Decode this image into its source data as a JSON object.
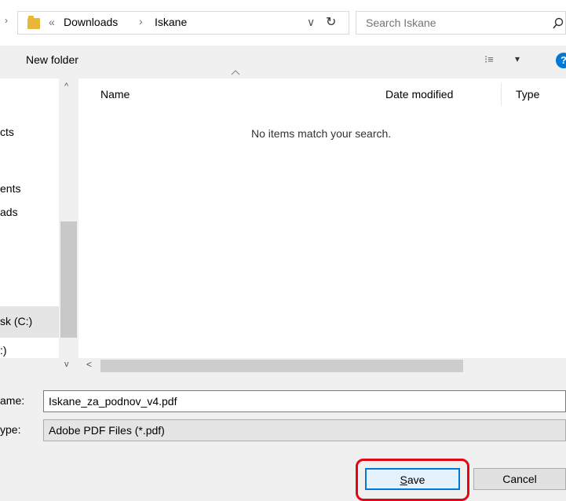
{
  "address": {
    "crumbs": [
      "«",
      "Downloads",
      "›",
      "Iskane"
    ],
    "dropdown_glyph": "∨",
    "refresh_glyph": "↻"
  },
  "search": {
    "placeholder": "Search Iskane",
    "icon": "search-icon"
  },
  "toolbar": {
    "new_folder": "New folder",
    "view_glyph": "⁝≡",
    "view_arrow": "▾",
    "help_glyph": "?"
  },
  "columns": {
    "name": "Name",
    "date_modified": "Date modified",
    "type": "Type"
  },
  "list": {
    "empty_message": "No items match your search."
  },
  "nav": {
    "items": [
      "cts",
      "ents",
      "ads",
      "sk (C:)",
      ":)"
    ],
    "up_arrow": "^",
    "down_arrow": "v"
  },
  "hscroll": {
    "left_arrow": "<"
  },
  "form": {
    "filename_label": "ame:",
    "filename_value": "Iskane_za_podnov_v4.pdf",
    "type_label": "ype:",
    "type_value": "Adobe PDF Files (*.pdf)"
  },
  "buttons": {
    "save": "Save",
    "save_mnemonic": "S",
    "save_rest": "ave",
    "cancel": "Cancel"
  },
  "colors": {
    "accent": "#0078d7",
    "highlight": "#e30613",
    "folder": "#e8b73a"
  }
}
